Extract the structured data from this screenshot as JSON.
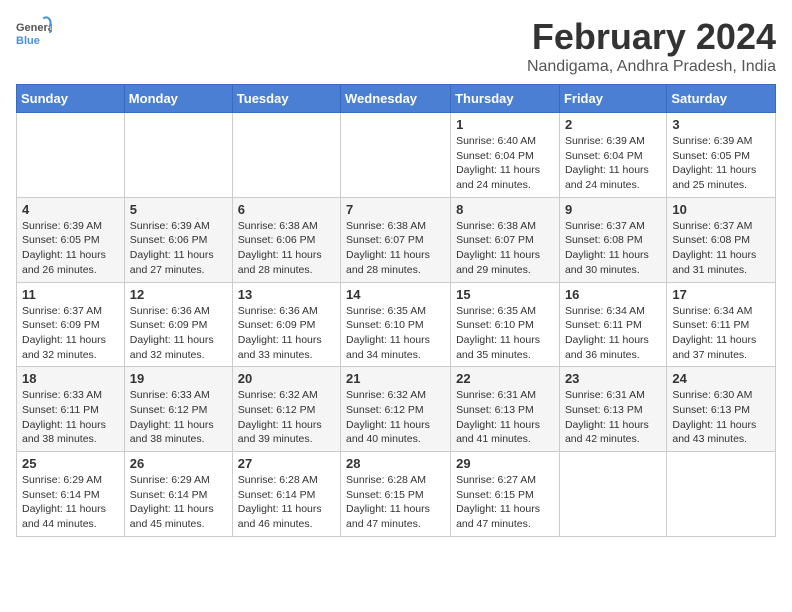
{
  "logo": {
    "text_general": "General",
    "text_blue": "Blue"
  },
  "header": {
    "title": "February 2024",
    "subtitle": "Nandigama, Andhra Pradesh, India"
  },
  "weekdays": [
    "Sunday",
    "Monday",
    "Tuesday",
    "Wednesday",
    "Thursday",
    "Friday",
    "Saturday"
  ],
  "weeks": [
    [
      {
        "day": "",
        "info": ""
      },
      {
        "day": "",
        "info": ""
      },
      {
        "day": "",
        "info": ""
      },
      {
        "day": "",
        "info": ""
      },
      {
        "day": "1",
        "info": "Sunrise: 6:40 AM\nSunset: 6:04 PM\nDaylight: 11 hours\nand 24 minutes."
      },
      {
        "day": "2",
        "info": "Sunrise: 6:39 AM\nSunset: 6:04 PM\nDaylight: 11 hours\nand 24 minutes."
      },
      {
        "day": "3",
        "info": "Sunrise: 6:39 AM\nSunset: 6:05 PM\nDaylight: 11 hours\nand 25 minutes."
      }
    ],
    [
      {
        "day": "4",
        "info": "Sunrise: 6:39 AM\nSunset: 6:05 PM\nDaylight: 11 hours\nand 26 minutes."
      },
      {
        "day": "5",
        "info": "Sunrise: 6:39 AM\nSunset: 6:06 PM\nDaylight: 11 hours\nand 27 minutes."
      },
      {
        "day": "6",
        "info": "Sunrise: 6:38 AM\nSunset: 6:06 PM\nDaylight: 11 hours\nand 28 minutes."
      },
      {
        "day": "7",
        "info": "Sunrise: 6:38 AM\nSunset: 6:07 PM\nDaylight: 11 hours\nand 28 minutes."
      },
      {
        "day": "8",
        "info": "Sunrise: 6:38 AM\nSunset: 6:07 PM\nDaylight: 11 hours\nand 29 minutes."
      },
      {
        "day": "9",
        "info": "Sunrise: 6:37 AM\nSunset: 6:08 PM\nDaylight: 11 hours\nand 30 minutes."
      },
      {
        "day": "10",
        "info": "Sunrise: 6:37 AM\nSunset: 6:08 PM\nDaylight: 11 hours\nand 31 minutes."
      }
    ],
    [
      {
        "day": "11",
        "info": "Sunrise: 6:37 AM\nSunset: 6:09 PM\nDaylight: 11 hours\nand 32 minutes."
      },
      {
        "day": "12",
        "info": "Sunrise: 6:36 AM\nSunset: 6:09 PM\nDaylight: 11 hours\nand 32 minutes."
      },
      {
        "day": "13",
        "info": "Sunrise: 6:36 AM\nSunset: 6:09 PM\nDaylight: 11 hours\nand 33 minutes."
      },
      {
        "day": "14",
        "info": "Sunrise: 6:35 AM\nSunset: 6:10 PM\nDaylight: 11 hours\nand 34 minutes."
      },
      {
        "day": "15",
        "info": "Sunrise: 6:35 AM\nSunset: 6:10 PM\nDaylight: 11 hours\nand 35 minutes."
      },
      {
        "day": "16",
        "info": "Sunrise: 6:34 AM\nSunset: 6:11 PM\nDaylight: 11 hours\nand 36 minutes."
      },
      {
        "day": "17",
        "info": "Sunrise: 6:34 AM\nSunset: 6:11 PM\nDaylight: 11 hours\nand 37 minutes."
      }
    ],
    [
      {
        "day": "18",
        "info": "Sunrise: 6:33 AM\nSunset: 6:11 PM\nDaylight: 11 hours\nand 38 minutes."
      },
      {
        "day": "19",
        "info": "Sunrise: 6:33 AM\nSunset: 6:12 PM\nDaylight: 11 hours\nand 38 minutes."
      },
      {
        "day": "20",
        "info": "Sunrise: 6:32 AM\nSunset: 6:12 PM\nDaylight: 11 hours\nand 39 minutes."
      },
      {
        "day": "21",
        "info": "Sunrise: 6:32 AM\nSunset: 6:12 PM\nDaylight: 11 hours\nand 40 minutes."
      },
      {
        "day": "22",
        "info": "Sunrise: 6:31 AM\nSunset: 6:13 PM\nDaylight: 11 hours\nand 41 minutes."
      },
      {
        "day": "23",
        "info": "Sunrise: 6:31 AM\nSunset: 6:13 PM\nDaylight: 11 hours\nand 42 minutes."
      },
      {
        "day": "24",
        "info": "Sunrise: 6:30 AM\nSunset: 6:13 PM\nDaylight: 11 hours\nand 43 minutes."
      }
    ],
    [
      {
        "day": "25",
        "info": "Sunrise: 6:29 AM\nSunset: 6:14 PM\nDaylight: 11 hours\nand 44 minutes."
      },
      {
        "day": "26",
        "info": "Sunrise: 6:29 AM\nSunset: 6:14 PM\nDaylight: 11 hours\nand 45 minutes."
      },
      {
        "day": "27",
        "info": "Sunrise: 6:28 AM\nSunset: 6:14 PM\nDaylight: 11 hours\nand 46 minutes."
      },
      {
        "day": "28",
        "info": "Sunrise: 6:28 AM\nSunset: 6:15 PM\nDaylight: 11 hours\nand 47 minutes."
      },
      {
        "day": "29",
        "info": "Sunrise: 6:27 AM\nSunset: 6:15 PM\nDaylight: 11 hours\nand 47 minutes."
      },
      {
        "day": "",
        "info": ""
      },
      {
        "day": "",
        "info": ""
      }
    ]
  ]
}
